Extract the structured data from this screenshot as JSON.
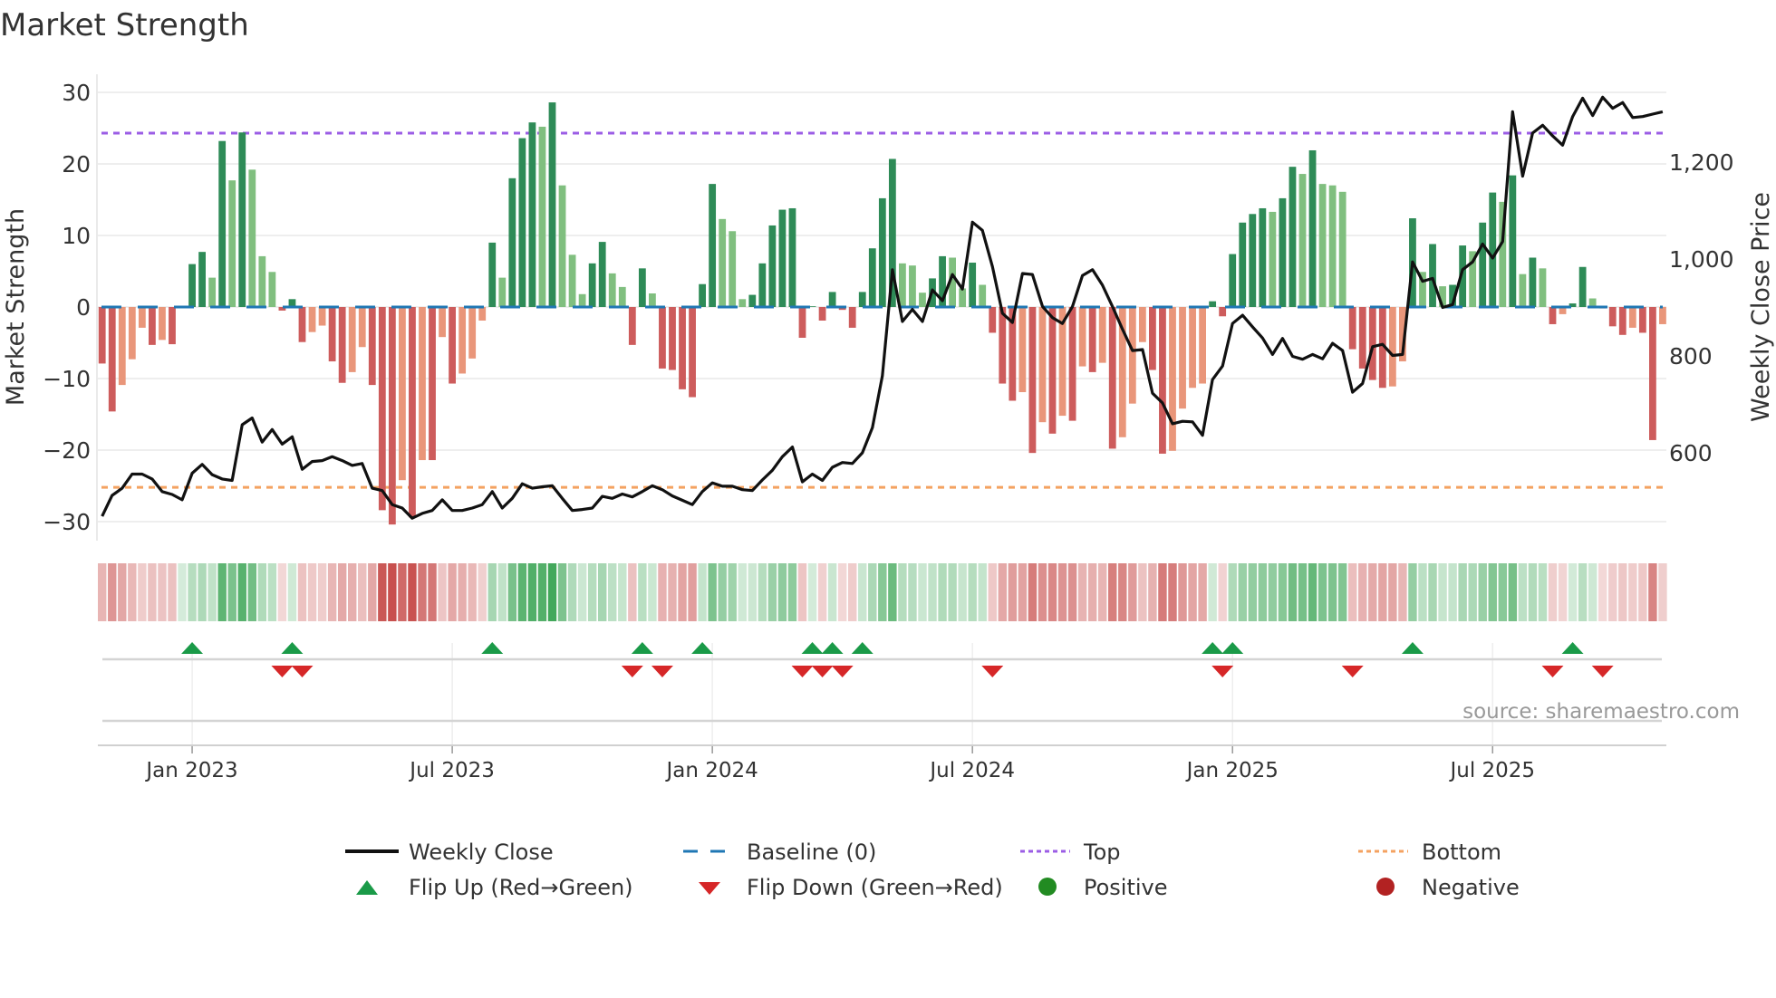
{
  "chart_data": {
    "type": "bar",
    "title": "Market Strength",
    "ylabel": "Market Strength",
    "y2label": "Weekly Close Price",
    "ylim": [
      -32.6,
      32.5
    ],
    "y2lim": [
      419,
      1381
    ],
    "yticks": [
      "30",
      "20",
      "10",
      "0",
      "−10",
      "−20",
      "−30"
    ],
    "ytick_values": [
      30,
      20,
      10,
      0,
      -10,
      -20,
      -30
    ],
    "y2ticks": [
      "1,200",
      "1,000",
      "800",
      "600"
    ],
    "y2tick_values": [
      1200,
      1000,
      800,
      600
    ],
    "xticks": [
      "Jan 2023",
      "Jul 2023",
      "Jan 2024",
      "Jul 2024",
      "Jan 2025",
      "Jul 2025"
    ],
    "xtick_week_index": [
      9,
      35,
      61,
      87,
      113,
      139
    ],
    "grid": true,
    "top_level": 24.3,
    "bottom_level": -25.2,
    "baseline": 0,
    "strength": [
      -7.9,
      -14.6,
      -10.9,
      -7.3,
      -2.9,
      -5.3,
      -4.6,
      -5.2,
      0,
      6.0,
      7.7,
      4.1,
      23.2,
      17.7,
      24.4,
      19.2,
      7.1,
      4.9,
      -0.5,
      1.1,
      -4.9,
      -3.5,
      -2.6,
      -7.6,
      -10.6,
      -9.1,
      -5.6,
      -10.9,
      -28.4,
      -30.4,
      -24.2,
      -29.4,
      -21.4,
      -21.4,
      -4.2,
      -10.7,
      -9.3,
      -7.2,
      -1.9,
      9.0,
      4.1,
      18.0,
      23.6,
      25.8,
      25.2,
      28.6,
      17.0,
      7.3,
      1.8,
      6.1,
      9.1,
      4.7,
      2.8,
      -5.3,
      5.4,
      1.9,
      -8.6,
      -8.8,
      -11.5,
      -12.6,
      3.2,
      17.2,
      12.3,
      10.6,
      1.1,
      1.7,
      6.1,
      11.4,
      13.6,
      13.8,
      -4.3,
      0.1,
      -1.9,
      2.1,
      -0.4,
      -2.9,
      2.1,
      8.2,
      15.2,
      20.7,
      6.1,
      5.8,
      2.0,
      4.0,
      7.1,
      6.9,
      2.6,
      6.2,
      3.1,
      -3.6,
      -10.7,
      -13.1,
      -11.9,
      -20.4,
      -16.1,
      -17.7,
      -15.2,
      -15.9,
      -8.3,
      -9.1,
      -7.8,
      -19.8,
      -18.2,
      -13.5,
      -4.9,
      -8.8,
      -20.5,
      -20.1,
      -14.2,
      -11.3,
      -10.7,
      0.8,
      -1.3,
      7.4,
      11.8,
      13.0,
      13.8,
      13.3,
      15.2,
      19.6,
      18.6,
      21.9,
      17.2,
      17.0,
      16.1,
      -5.9,
      -8.6,
      -10.2,
      -11.3,
      -11.1,
      -7.6,
      12.4,
      4.9,
      8.8,
      2.9,
      3.1,
      8.6,
      7.8,
      11.8,
      16.0,
      14.7,
      18.4,
      4.6,
      6.9,
      5.4,
      -2.4,
      -1.0,
      0.5,
      5.6,
      1.2,
      -0.2,
      -2.7,
      -3.9,
      -2.9,
      -3.6,
      -18.6,
      -2.4
    ],
    "weekly_close": [
      469,
      512,
      527,
      556,
      556,
      546,
      520,
      514,
      503,
      558,
      576,
      555,
      546,
      543,
      658,
      672,
      622,
      648,
      618,
      633,
      566,
      582,
      584,
      592,
      584,
      574,
      578,
      527,
      522,
      493,
      486,
      465,
      475,
      481,
      503,
      481,
      481,
      486,
      493,
      520,
      486,
      506,
      536,
      527,
      530,
      532,
      506,
      481,
      483,
      486,
      510,
      506,
      515,
      509,
      520,
      532,
      524,
      511,
      502,
      493,
      520,
      538,
      531,
      531,
      524,
      522,
      544,
      564,
      592,
      612,
      540,
      556,
      543,
      570,
      580,
      578,
      600,
      652,
      759,
      978,
      871,
      896,
      871,
      936,
      914,
      968,
      938,
      1076,
      1059,
      984,
      888,
      869,
      970,
      968,
      902,
      879,
      867,
      902,
      966,
      978,
      946,
      902,
      855,
      811,
      813,
      723,
      703,
      660,
      665,
      664,
      636,
      751,
      779,
      867,
      884,
      860,
      837,
      803,
      836,
      799,
      793,
      803,
      794,
      826,
      811,
      725,
      743,
      819,
      824,
      801,
      803,
      994,
      954,
      960,
      900,
      906,
      978,
      994,
      1031,
      1002,
      1036,
      1304,
      1171,
      1260,
      1276,
      1254,
      1235,
      1294,
      1332,
      1296,
      1334,
      1311,
      1323,
      1292,
      1294,
      1299,
      1304
    ],
    "flip_up_weeks": [
      10,
      20,
      40,
      55,
      61,
      72,
      74,
      77,
      112,
      114,
      132,
      148
    ],
    "flip_down_weeks": [
      19,
      21,
      54,
      57,
      71,
      73,
      75,
      90,
      113,
      126,
      146,
      151
    ],
    "legend": {
      "placement": "bottom",
      "weekly_close": "Weekly Close",
      "baseline": "Baseline (0)",
      "top": "Top",
      "bottom": "Bottom",
      "flip_up": "Flip Up (Red→Green)",
      "flip_down": "Flip Down (Green→Red)",
      "positive": "Positive",
      "negative": "Negative"
    },
    "source": "source: sharemaestro.com",
    "colors": {
      "pos_strong": "#2e8b57",
      "pos_weak": "#80bf7f",
      "neg_strong": "#cd5c5c",
      "neg_weak": "#e9967a",
      "line": "#111111",
      "baseline": "#1f77b4",
      "top": "#9b5de5",
      "bottom": "#f4a261",
      "flip_up": "#1a9a48",
      "flip_down": "#d62728",
      "positive": "#228b22",
      "negative": "#b22222"
    }
  }
}
